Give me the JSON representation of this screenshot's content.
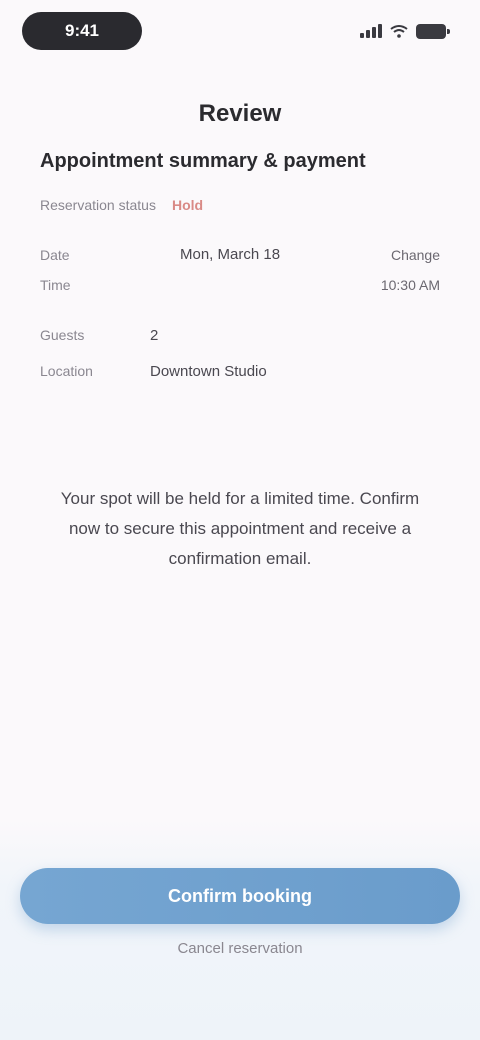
{
  "status_bar": {
    "time": "9:41"
  },
  "header": {
    "title": "Review"
  },
  "details": {
    "title": "Appointment summary & payment",
    "subtitle": "Reservation status",
    "badge": "Hold",
    "primary_row": {
      "label": "Date",
      "label_2": "Time",
      "value": "Mon, March 18",
      "right": "Change",
      "right_2": "10:30 AM"
    },
    "fields": [
      {
        "label": "Guests",
        "value": "2"
      },
      {
        "label": "Location",
        "value": "Downtown Studio"
      }
    ]
  },
  "description": "Your spot will be held for a limited time. Confirm now to secure this appointment and receive a confirmation email.",
  "actions": {
    "primary": "Confirm booking",
    "secondary": "Cancel reservation"
  }
}
